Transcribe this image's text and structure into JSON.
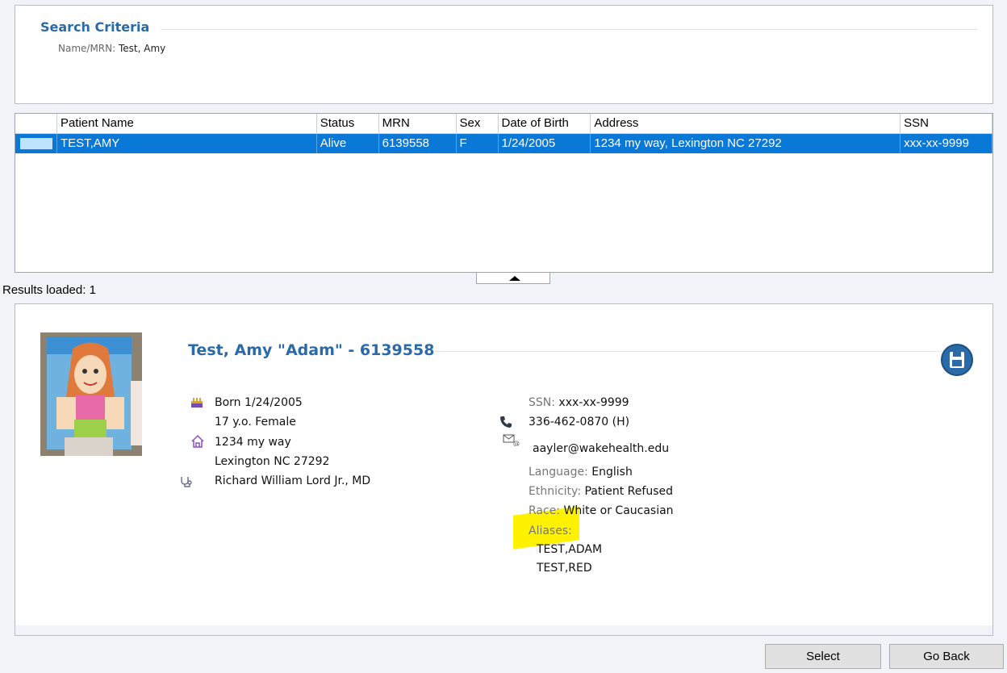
{
  "criteria": {
    "title": "Search Criteria",
    "name_label": "Name/MRN:",
    "name_value": "Test, Amy"
  },
  "grid": {
    "columns": [
      "",
      "Patient Name",
      "Status",
      "MRN",
      "Sex",
      "Date of Birth",
      "Address",
      "SSN"
    ],
    "rows": [
      {
        "name": "TEST,AMY",
        "status": "Alive",
        "mrn": "6139558",
        "sex": "F",
        "dob": "1/24/2005",
        "address": "1234 my way, Lexington NC 27292",
        "ssn": "xxx-xx-9999"
      }
    ]
  },
  "results_loaded": "Results loaded: 1",
  "patient": {
    "title": "Test, Amy \"Adam\" - 6139558",
    "born": "Born 1/24/2005",
    "age_sex": "17 y.o. Female",
    "address_line1": "1234 my way",
    "address_line2": "Lexington NC 27292",
    "provider": "Richard William Lord Jr., MD",
    "ssn_label": "SSN:",
    "ssn_value": "xxx-xx-9999",
    "phone": "336-462-0870 (H)",
    "email": "aayler@wakehealth.edu",
    "language_label": "Language:",
    "language_value": "English",
    "ethnicity_label": "Ethnicity:",
    "ethnicity_value": "Patient Refused",
    "race_label": "Race:",
    "race_value": "White or Caucasian",
    "aliases_label": "Aliases:",
    "aliases": [
      "TEST,ADAM",
      "TEST,RED"
    ]
  },
  "buttons": {
    "select": "Select",
    "go_back": "Go Back"
  },
  "colors": {
    "accent": "#2a6aa8",
    "row_selected": "#0a78d7",
    "highlight": "#fff200"
  }
}
